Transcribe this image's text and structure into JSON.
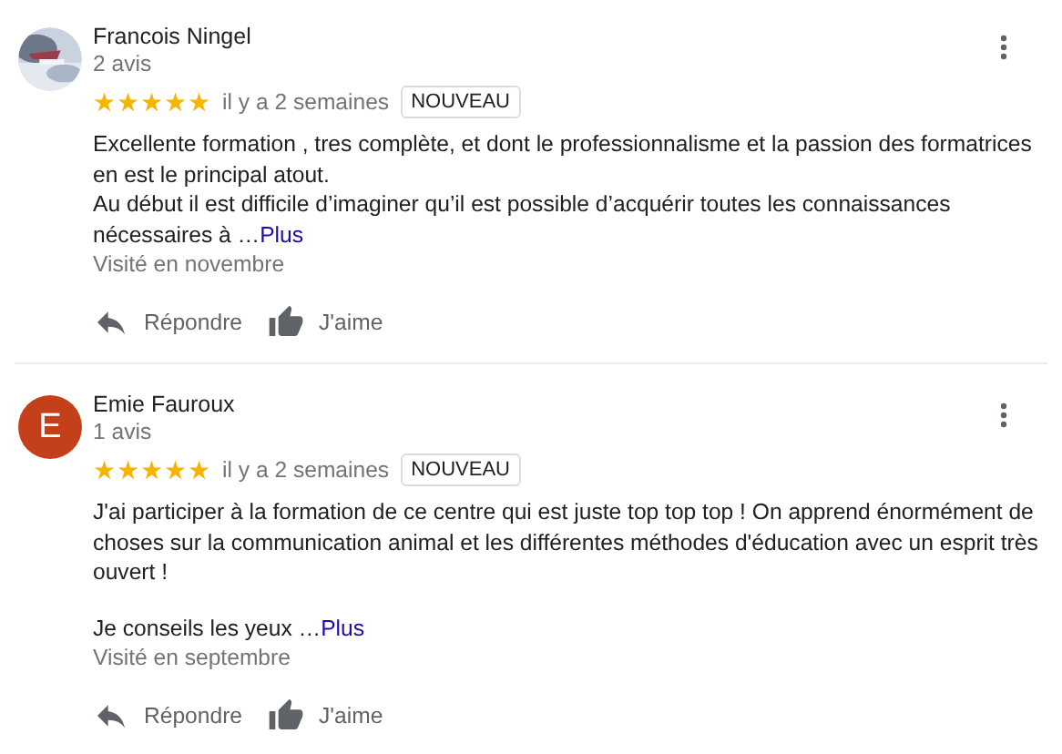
{
  "reviews": [
    {
      "author": "Francois Ningel",
      "count": "2 avis",
      "stars": 5,
      "time": "il y a 2 semaines",
      "badge": "NOUVEAU",
      "paragraphs": [
        "Excellente formation , tres complète, et dont le professionnalisme et la passion des formatrices en est le principal atout.",
        "Au début il est difficile d’imaginer qu’il est possible d’acquérir toutes les connaissances nécessaires à …"
      ],
      "more": "Plus",
      "visited": "Visité en novembre",
      "actions": [
        "Répondre",
        "J'aime"
      ]
    },
    {
      "author": "Emie Fauroux",
      "avatar": {
        "kind": "letter",
        "letter": "E",
        "color": "#c4401a"
      },
      "count": "1 avis",
      "stars": 5,
      "time": "il y a 2 semaines",
      "badge": "NOUVEAU",
      "paragraphs": [
        "J'ai participer à la formation de ce centre qui est juste top top top ! On apprend énormément de choses sur la communication animal et les différentes méthodes d'éducation avec un esprit très ouvert !",
        "Je conseils les yeux …"
      ],
      "more": "Plus",
      "visited": "Visité en septembre",
      "actions": [
        "Répondre",
        "J'aime"
      ]
    }
  ]
}
